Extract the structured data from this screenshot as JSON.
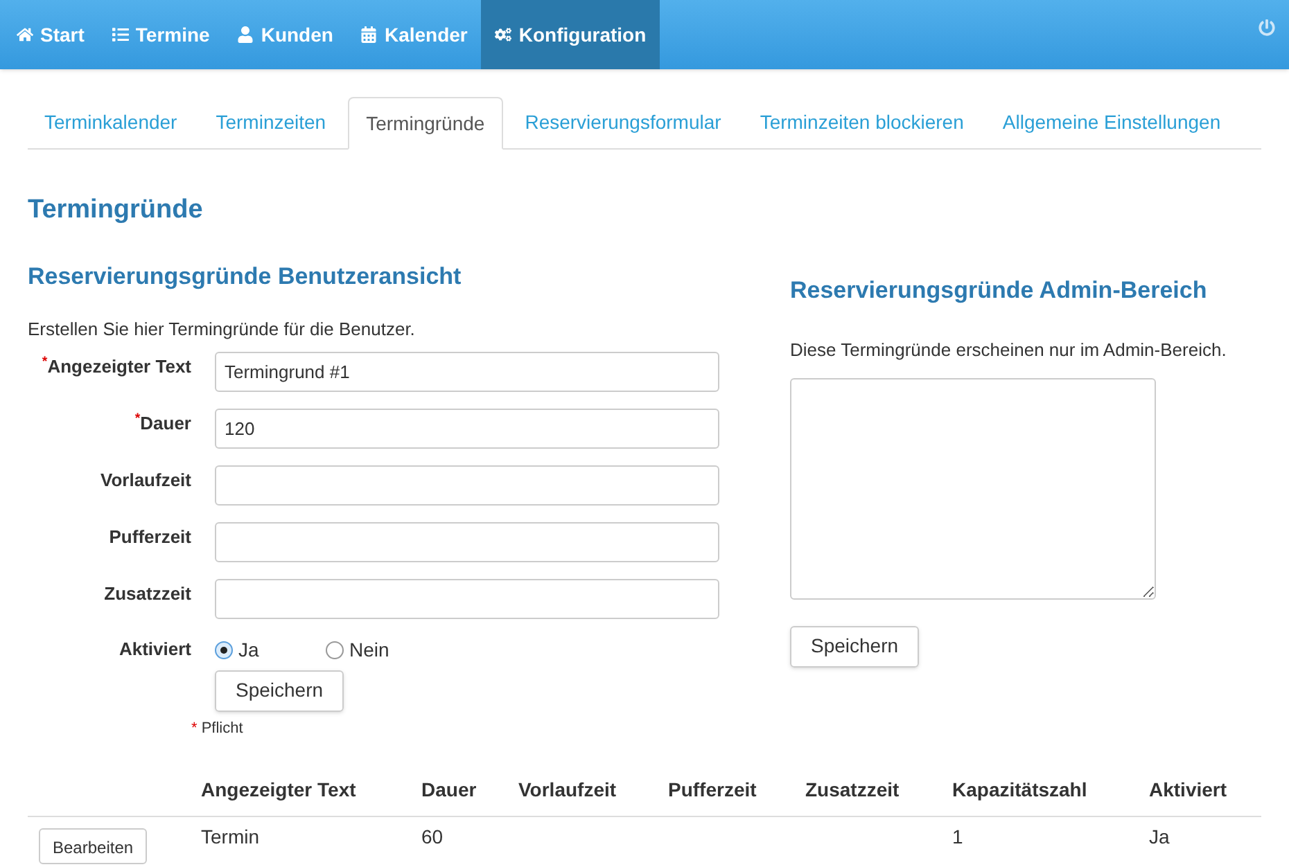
{
  "nav": [
    {
      "label": "Start",
      "selected": false
    },
    {
      "label": "Termine",
      "selected": false
    },
    {
      "label": "Kunden",
      "selected": false
    },
    {
      "label": "Kalender",
      "selected": false
    },
    {
      "label": "Konfiguration",
      "selected": true
    }
  ],
  "tabs": [
    {
      "label": "Terminkalender",
      "selected": false
    },
    {
      "label": "Terminzeiten",
      "selected": false
    },
    {
      "label": "Termingründe",
      "selected": true
    },
    {
      "label": "Reservierungsformular",
      "selected": false
    },
    {
      "label": "Terminzeiten blockieren",
      "selected": false
    },
    {
      "label": "Allgemeine Einstellungen",
      "selected": false
    }
  ],
  "page_title": "Termingründe",
  "user_section": {
    "title": "Reservierungsgründe Benutzeransicht",
    "description": "Erstellen Sie hier Termingründe für die Benutzer.",
    "fields": [
      {
        "label": "Angezeigter Text",
        "required_mark": "*",
        "value": "Termingrund #1"
      },
      {
        "label": "Dauer",
        "required_mark": "*",
        "value": "120"
      },
      {
        "label": "Vorlaufzeit"
      },
      {
        "label": "Pufferzeit"
      },
      {
        "label": "Zusatzzeit"
      }
    ],
    "activated": {
      "label": "Aktiviert",
      "options": [
        {
          "label": "Ja",
          "selected": true
        },
        {
          "label": "Nein",
          "selected": false
        }
      ]
    },
    "save_button": "Speichern",
    "required_note": {
      "mark": "*",
      "text": "Pflicht"
    }
  },
  "admin_section": {
    "title": "Reservierungsgründe Admin-Bereich",
    "description": "Diese Termingründe erscheinen nur im Admin-Bereich.",
    "save_button": "Speichern"
  },
  "table": {
    "columns": [
      "Angezeigter Text",
      "Dauer",
      "Vorlaufzeit",
      "Pufferzeit",
      "Zusatzzeit",
      "Kapazitätszahl",
      "Aktiviert"
    ],
    "rows": [
      {
        "button": "Bearbeiten",
        "cells": [
          "Termin",
          "60",
          "",
          "",
          "",
          "1",
          "Ja"
        ]
      }
    ]
  }
}
